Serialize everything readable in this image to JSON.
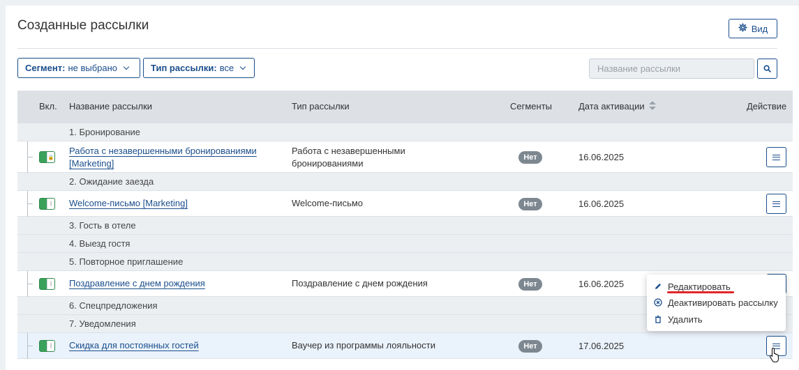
{
  "page": {
    "title": "Созданные рассылки",
    "view_label": "Вид"
  },
  "filters": [
    {
      "key": "Сегмент:",
      "value": "не выбрано"
    },
    {
      "key": "Тип рассылки:",
      "value": "все"
    }
  ],
  "search": {
    "placeholder": "Название рассылки"
  },
  "table": {
    "headers": {
      "enabled": "Вкл.",
      "name": "Название рассылки",
      "type": "Тип рассылки",
      "segments": "Сегменты",
      "date": "Дата активации",
      "action": "Действие"
    },
    "groups": [
      "1. Бронирование",
      "2. Ожидание заезда",
      "3. Гость в отеле",
      "4. Выезд гостя",
      "5. Повторное приглашение",
      "6. Спецпредложения",
      "7. Уведомления"
    ],
    "rows": [
      {
        "name_line1": "Работа с незавершенными бронированиями",
        "name_line2": "[Marketing]",
        "type_line1": "Работа с незавершенными",
        "type_line2": "бронированиями",
        "segments": "Нет",
        "date": "16.06.2025",
        "locked": true
      },
      {
        "name": "Welcome-письмо  [Marketing]",
        "type": "Welcome-письмо",
        "segments": "Нет",
        "date": "16.06.2025"
      },
      {
        "name": "Поздравление с днем рождения",
        "type": "Поздравление с днем рождения",
        "segments": "Нет",
        "date": "16.06.2025"
      },
      {
        "name": "Скидка для постоянных гостей",
        "type": "Ваучер из программы лояльности",
        "segments": "Нет",
        "date": "17.06.2025"
      }
    ]
  },
  "action_menu": {
    "edit": "Редактировать",
    "deactivate": "Деактивировать рассылку",
    "delete": "Удалить"
  },
  "colors": {
    "accent": "#1a4e8c",
    "toggle_on": "#3aa25a",
    "badge": "#7d8790",
    "highlight_underline": "#e0262a"
  }
}
